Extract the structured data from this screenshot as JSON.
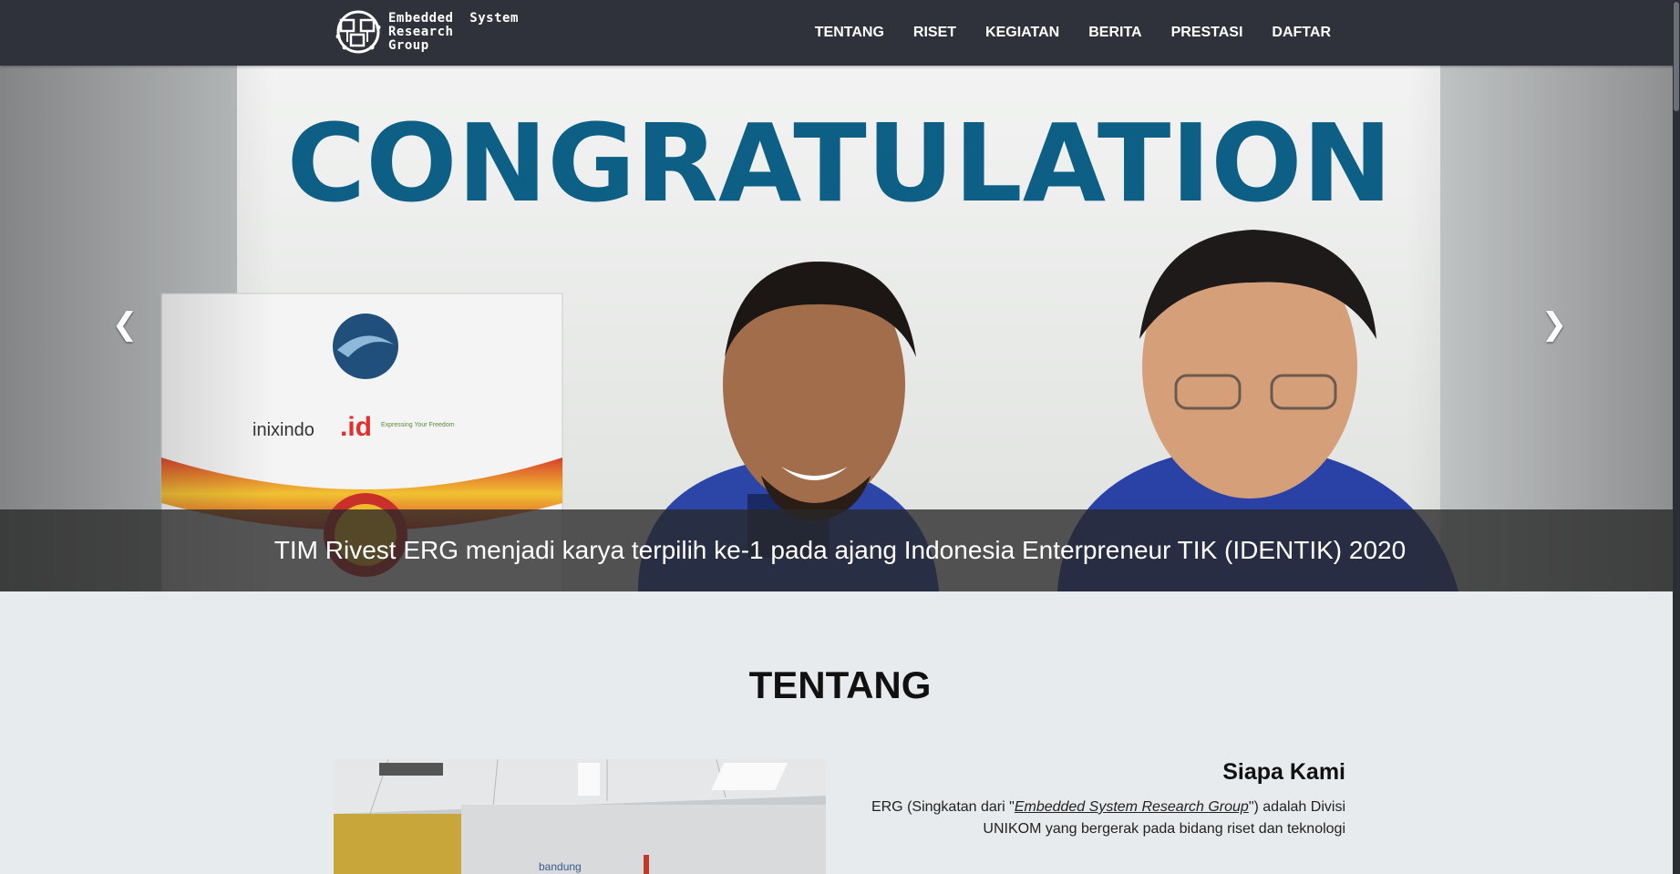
{
  "brand": {
    "logo_text_lines": [
      "Embedded",
      "Research",
      "Group"
    ],
    "logo_text_extra": "System",
    "icon": "erg-circuit-logo-icon"
  },
  "nav": {
    "items": [
      {
        "label": "TENTANG"
      },
      {
        "label": "RISET"
      },
      {
        "label": "KEGIATAN"
      },
      {
        "label": "BERITA"
      },
      {
        "label": "PRESTASI"
      },
      {
        "label": "DAFTAR"
      }
    ]
  },
  "carousel": {
    "slide_heading": "CONGRATULATION",
    "board_logos": [
      "inixindo",
      ".id",
      "Expressing Your Freedom"
    ],
    "caption": "TIM Rivest ERG menjadi karya terpilih ke-1 pada ajang Indonesia Enterpreneur TIK (IDENTIK) 2020",
    "prev_icon": "chevron-left-icon",
    "next_icon": "chevron-right-icon",
    "prev_glyph": "❮",
    "next_glyph": "❯"
  },
  "about": {
    "section_title": "TENTANG",
    "heading": "Siapa Kami",
    "desc_prefix": "ERG (Singkatan dari \"",
    "desc_term": "Embedded System Research Group",
    "desc_suffix": "\") adalah Divisi UNIKOM yang bergerak pada bidang riset dan teknologi",
    "photo_sign": "bandung"
  },
  "colors": {
    "navbar_bg": "#2f323a",
    "congrats_text": "#0d5f86",
    "page_bg": "#e8ebee"
  }
}
